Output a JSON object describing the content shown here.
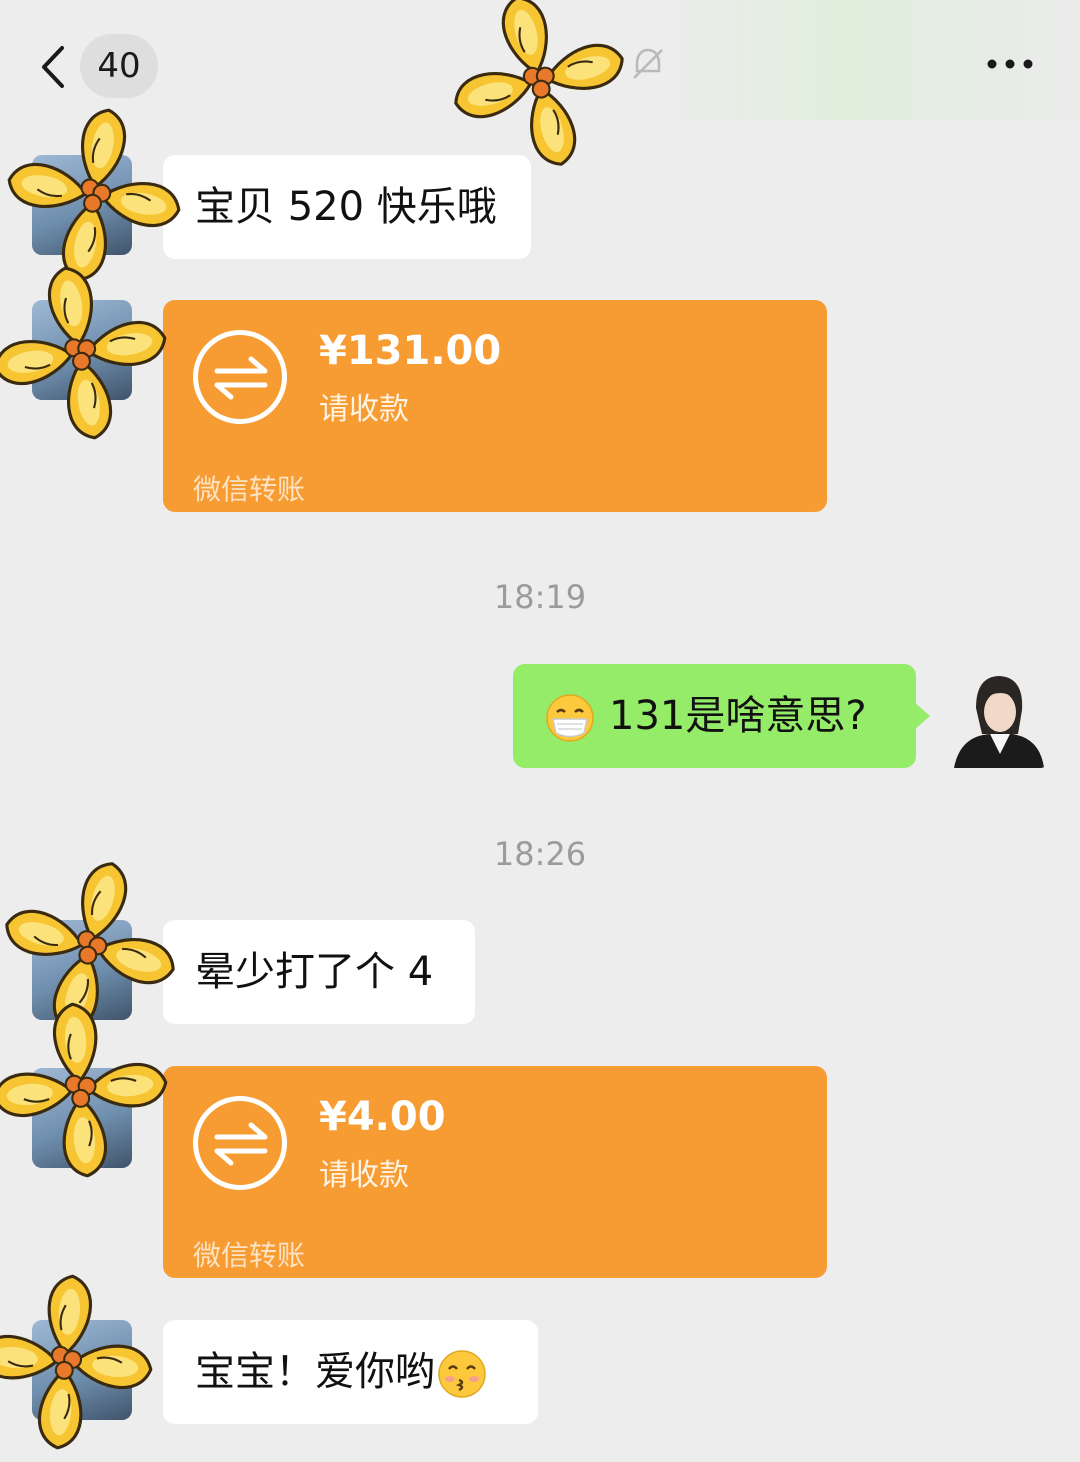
{
  "header": {
    "unread_count": "40",
    "back_icon": "chevron-left-icon",
    "mute_icon": "bell-mute-icon",
    "more_icon": "more-dots-icon"
  },
  "messages": [
    {
      "side": "left",
      "type": "text",
      "text": "宝贝 520 快乐哦"
    },
    {
      "side": "left",
      "type": "transfer",
      "amount": "¥131.00",
      "status": "请收款",
      "footer": "微信转账"
    },
    {
      "type": "timestamp",
      "text": "18:19"
    },
    {
      "side": "right",
      "type": "text",
      "emoji": "mask-face-emoji",
      "text": "131是啥意思?"
    },
    {
      "type": "timestamp",
      "text": "18:26"
    },
    {
      "side": "left",
      "type": "text",
      "text": "晕少打了个 4"
    },
    {
      "side": "left",
      "type": "transfer",
      "amount": "¥4.00",
      "status": "请收款",
      "footer": "微信转账"
    },
    {
      "side": "left",
      "type": "text",
      "text": "宝宝！爱你哟",
      "emoji": "kissing-face-emoji"
    }
  ],
  "colors": {
    "background": "#ededed",
    "bubble_left": "#ffffff",
    "bubble_right": "#95ec69",
    "transfer": "#f79c32",
    "flower": "#f7c531"
  }
}
